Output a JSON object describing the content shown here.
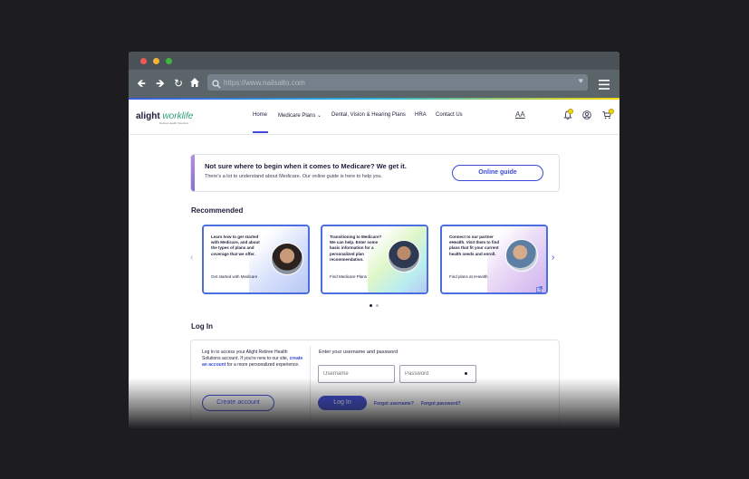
{
  "browser": {
    "url": "https://www.nailsalto.com",
    "colors": {
      "close": "#ee5a52",
      "minimize": "#f2b535",
      "maximize": "#3fb640"
    }
  },
  "header": {
    "logo_brand": "alight",
    "logo_product": "worklife",
    "logo_sub": "Retiree Health Solutions",
    "nav": [
      "Home",
      "Medicare Plans",
      "Dental, Vision & Hearing Plans",
      "HRA",
      "Contact Us"
    ],
    "nav_dropdown_glyph": "⌄",
    "text_size": "AA",
    "icons": [
      "bell-icon",
      "user-icon",
      "cart-icon"
    ]
  },
  "banner": {
    "title": "Not sure where to begin when it comes to Medicare? We get it.",
    "description": "There's a lot to understand about Medicare. Our online guide is here to help you.",
    "button": "Online guide"
  },
  "recommended": {
    "title": "Recommended",
    "cards": [
      {
        "text": "Learn how to get started with Medicare, and about the types of plans and coverage that we offer.",
        "link": "Get started with Medicare"
      },
      {
        "text": "Transitioning to Medicare? We can help. Enter some basic information for a personalized plan recommendation.",
        "link": "Find Medicare Plans"
      },
      {
        "text": "Connect to our partner eHealth. Visit them to find plans that fit your current health needs and enroll.",
        "link": "Find plans at eHealth"
      }
    ],
    "active_page": 1,
    "page_count": 2
  },
  "login": {
    "title": "Log In",
    "description_before": "Log In to access your Alight Retiree Health Solutions account. If you're new to our site, ",
    "create_link": "create an account",
    "description_after": " for a more personalized experience.",
    "prompt": "Enter your username and password",
    "username_placeholder": "Username",
    "password_placeholder": "Password",
    "create_button": "Create account",
    "login_button": "Log In",
    "forgot_username": "Forgot username?",
    "forgot_password": "Forgot password?"
  }
}
